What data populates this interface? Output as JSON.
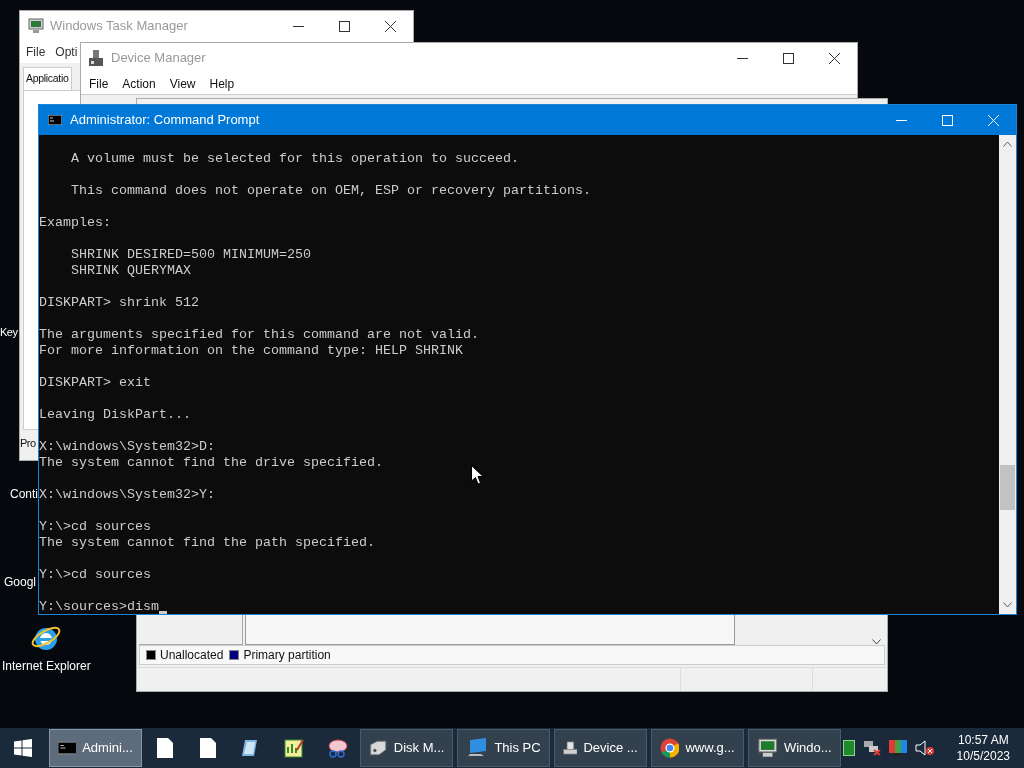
{
  "desktop_icons": [
    {
      "kind": "text",
      "label": "Key"
    },
    {
      "kind": "text",
      "label": "Conti"
    },
    {
      "kind": "text",
      "label": "Googl"
    },
    {
      "kind": "browser",
      "label": "Internet Explorer"
    }
  ],
  "task_manager": {
    "title": "Windows Task Manager",
    "menu": [
      "File",
      "Opti"
    ],
    "tab": "Applicatio",
    "button": "Pro"
  },
  "device_manager": {
    "title": "Device Manager",
    "menu": [
      "File",
      "Action",
      "View",
      "Help"
    ]
  },
  "disk_management": {
    "legend": [
      {
        "label": "Unallocated",
        "color": "#000000"
      },
      {
        "label": "Primary partition",
        "color": "#000080"
      }
    ]
  },
  "command_prompt": {
    "title": "Administrator: Command Prompt",
    "blocks": [
      [
        "    A volume must be selected for this operation to succeed."
      ],
      [
        "    This command does not operate on OEM, ESP or recovery partitions."
      ],
      [
        "Examples:"
      ],
      [
        "    SHRINK DESIRED=500 MINIMUM=250",
        "    SHRINK QUERYMAX"
      ],
      [
        "DISKPART> shrink 512"
      ],
      [
        "The arguments specified for this command are not valid.",
        "For more information on the command type: HELP SHRINK"
      ],
      [
        "DISKPART> exit"
      ],
      [
        "Leaving DiskPart..."
      ],
      [
        "X:\\windows\\System32>D:",
        "The system cannot find the drive specified."
      ],
      [
        "X:\\windows\\System32>Y:"
      ],
      [
        "Y:\\>cd sources",
        "The system cannot find the path specified."
      ],
      [
        "Y:\\>cd sources"
      ],
      [
        "Y:\\sources>dism"
      ]
    ]
  },
  "taskbar": {
    "items": [
      {
        "kind": "window",
        "label": "Admini...",
        "selected": true
      },
      {
        "kind": "pinned",
        "selected": false
      },
      {
        "kind": "pinned",
        "selected": false
      },
      {
        "kind": "pinned",
        "selected": false
      },
      {
        "kind": "pinned",
        "selected": false
      },
      {
        "kind": "pinned",
        "selected": false
      },
      {
        "kind": "window",
        "label": "Disk M...",
        "selected": false
      },
      {
        "kind": "window",
        "label": "This PC",
        "selected": false
      },
      {
        "kind": "window",
        "label": "Device ...",
        "selected": false
      },
      {
        "kind": "window",
        "label": "www.g...",
        "selected": false
      },
      {
        "kind": "window",
        "label": "Windo...",
        "selected": false
      }
    ],
    "clock": {
      "time": "10:57 AM",
      "date": "10/5/2023"
    }
  }
}
